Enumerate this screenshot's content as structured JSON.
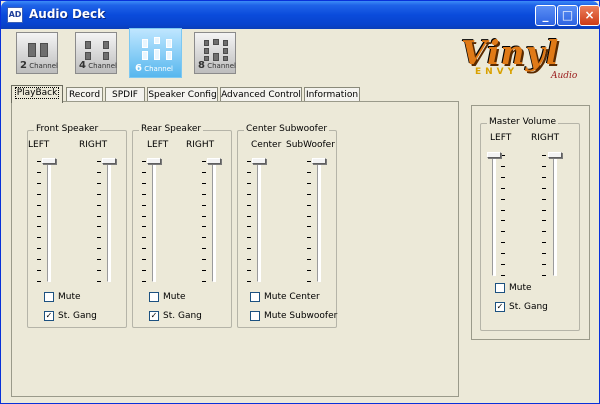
{
  "window": {
    "title": "Audio Deck",
    "app_icon": "AD"
  },
  "title_buttons": {
    "minimize": "_",
    "maximize": "□",
    "close": "×"
  },
  "channels": [
    {
      "num": "2",
      "word": "Channel",
      "icon": "speaker-2ch-icon",
      "active": false
    },
    {
      "num": "4",
      "word": "Channel",
      "icon": "speaker-4ch-icon",
      "active": false
    },
    {
      "num": "6",
      "word": "Channel",
      "icon": "speaker-6ch-icon",
      "active": true
    },
    {
      "num": "8",
      "word": "Channel",
      "icon": "speaker-8ch-icon",
      "active": false
    }
  ],
  "logo": {
    "main": "Vinyl",
    "envy": "ENVY",
    "sub": "Audio"
  },
  "tabs": [
    "PlayBack",
    "Record",
    "SPDIF",
    "Speaker Config",
    "Advanced Control",
    "Information"
  ],
  "active_tab": "PlayBack",
  "groups": {
    "front": {
      "title": "Front Speaker",
      "left": "LEFT",
      "right": "RIGHT",
      "left_level": 1.0,
      "right_level": 1.0,
      "mute_label": "Mute",
      "mute_checked": false,
      "gang_label": "St. Gang",
      "gang_checked": true
    },
    "rear": {
      "title": "Rear Speaker",
      "left": "LEFT",
      "right": "RIGHT",
      "left_level": 1.0,
      "right_level": 1.0,
      "mute_label": "Mute",
      "mute_checked": false,
      "gang_label": "St. Gang",
      "gang_checked": true
    },
    "center_sub": {
      "title": "Center Subwoofer",
      "left": "Center",
      "right": "SubWoofer",
      "left_level": 1.0,
      "right_level": 1.0,
      "mute_center_label": "Mute Center",
      "mute_center_checked": false,
      "mute_sub_label": "Mute Subwoofer",
      "mute_sub_checked": false
    }
  },
  "master": {
    "title": "Master Volume",
    "left": "LEFT",
    "right": "RIGHT",
    "left_level": 1.0,
    "right_level": 1.0,
    "mute_label": "Mute",
    "mute_checked": false,
    "gang_label": "St. Gang",
    "gang_checked": true
  },
  "check_mark": "✓",
  "colors": {
    "titlebar": "#0A4BDB",
    "accent": "#57B7EE",
    "logo": "#E07A17"
  }
}
